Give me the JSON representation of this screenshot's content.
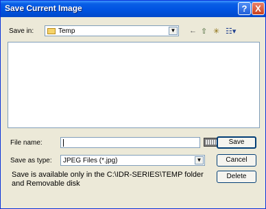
{
  "window": {
    "title": "Save Current Image"
  },
  "titlebar": {
    "help_glyph": "?",
    "close_glyph": "X"
  },
  "toolbar": {
    "save_in_label": "Save in:",
    "save_in_value": "Temp",
    "dropdown_glyph": "▼",
    "back_glyph": "←",
    "up_glyph": "⇧",
    "new_folder_glyph": "✳",
    "view_glyph": "☷▾"
  },
  "fields": {
    "file_name_label": "File name:",
    "file_name_value": "",
    "save_as_type_label": "Save as type:",
    "save_as_type_value": "JPEG Files (*.jpg)"
  },
  "buttons": {
    "save": "Save",
    "cancel": "Cancel",
    "delete": "Delete"
  },
  "info": {
    "text": "Save is available only in the C:\\IDR-SERIES\\TEMP folder and Removable disk"
  }
}
